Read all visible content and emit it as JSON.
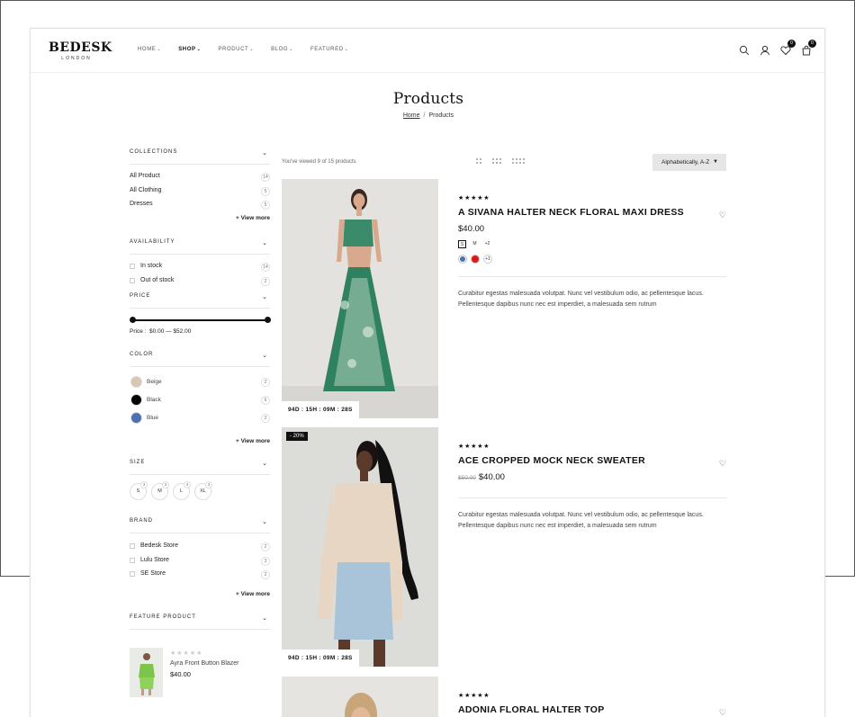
{
  "brand": {
    "name": "BEDESK",
    "tagline": "LONDON"
  },
  "nav": [
    {
      "label": "HOME"
    },
    {
      "label": "SHOP"
    },
    {
      "label": "PRODUCT"
    },
    {
      "label": "BLOG"
    },
    {
      "label": "FEATURED"
    }
  ],
  "header_icons": {
    "wishlist_count": "0",
    "cart_count": "0"
  },
  "page": {
    "title": "Products",
    "breadcrumb_home": "Home",
    "breadcrumb_sep": "/",
    "breadcrumb_current": "Products"
  },
  "filters": {
    "collections": {
      "title": "COLLECTIONS",
      "items": [
        {
          "label": "All Product",
          "count": "14"
        },
        {
          "label": "All Clothing",
          "count": "5"
        },
        {
          "label": "Dresses",
          "count": "5"
        }
      ],
      "view_more": "+ View more"
    },
    "availability": {
      "title": "AVAILABILITY",
      "items": [
        {
          "label": "In stock",
          "count": "14"
        },
        {
          "label": "Out of stock",
          "count": "2"
        }
      ]
    },
    "price": {
      "title": "PRICE",
      "label": "Price :",
      "range": "$0.00 — $52.00",
      "min_fraction": 0,
      "max_fraction": 1
    },
    "color": {
      "title": "COLOR",
      "items": [
        {
          "label": "Beige",
          "count": "2",
          "color": "#d9c7b5"
        },
        {
          "label": "Black",
          "count": "6",
          "color": "#000000"
        },
        {
          "label": "Blue",
          "count": "2",
          "color": "#4d70b0"
        }
      ],
      "view_more": "+ View more"
    },
    "size": {
      "title": "SIZE",
      "items": [
        {
          "label": "S",
          "count": "3"
        },
        {
          "label": "M",
          "count": "3"
        },
        {
          "label": "L",
          "count": "3"
        },
        {
          "label": "XL",
          "count": "3"
        }
      ]
    },
    "brand": {
      "title": "BRAND",
      "items": [
        {
          "label": "Bedesk Store",
          "count": "2"
        },
        {
          "label": "Lulu Store",
          "count": "3"
        },
        {
          "label": "SE Store",
          "count": "2"
        }
      ],
      "view_more": "+ View more"
    },
    "feature": {
      "title": "FEATURE PRODUCT",
      "name": "Ayra Front Button Blazer",
      "price": "$40.00",
      "stars": "★★★★★"
    }
  },
  "toolbar": {
    "viewed": "You've viewed 9 of 15 products",
    "sort": "Alphabetically, A-Z"
  },
  "products": [
    {
      "stars": "★★★★★",
      "name": "A SIVANA HALTER NECK FLORAL MAXI DRESS",
      "price": "$40.00",
      "timer": "94D : 15H : 09M : 28S",
      "sizes": [
        "S",
        "M",
        "+2"
      ],
      "colors": [
        "#4d70b0",
        "#e31414"
      ],
      "colors_more": "+1",
      "desc": "Curabitur egestas malesuada volutpat. Nunc vel vestibulum odio, ac pellentesque lacus. Pellentesque dapibus nunc nec est imperdiet, a malesuada sem rutrum"
    },
    {
      "stars": "★★★★★",
      "name": "ACE CROPPED MOCK NECK SWEATER",
      "old_price": "$50.00",
      "price": "$40.00",
      "badge": "- 20%",
      "timer": "94D : 15H : 09M : 28S",
      "desc": "Curabitur egestas malesuada volutpat. Nunc vel vestibulum odio, ac pellentesque lacus. Pellentesque dapibus nunc nec est imperdiet, a malesuada sem rutrum"
    },
    {
      "stars": "★★★★★",
      "name": "ADONIA FLORAL HALTER TOP"
    }
  ]
}
